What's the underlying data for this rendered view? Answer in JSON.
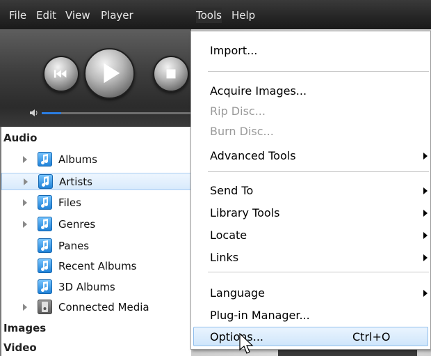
{
  "menubar": {
    "items": [
      "File",
      "Edit",
      "View",
      "Player",
      "Tools",
      "Help"
    ]
  },
  "library": {
    "audio_header": "Audio",
    "audio_items": [
      {
        "label": "Albums",
        "expandable": true
      },
      {
        "label": "Artists",
        "expandable": true,
        "selected": true
      },
      {
        "label": "Files",
        "expandable": true
      },
      {
        "label": "Genres",
        "expandable": true
      },
      {
        "label": "Panes",
        "expandable": false
      },
      {
        "label": "Recent Albums",
        "expandable": false
      },
      {
        "label": "3D Albums",
        "expandable": false
      },
      {
        "label": "Connected Media",
        "expandable": true
      }
    ],
    "images_header": "Images",
    "video_header": "Video"
  },
  "tools_menu": {
    "items": [
      {
        "label": "Import...",
        "disabled": false
      },
      {
        "label": "Acquire Images...",
        "disabled": false
      },
      {
        "label": "Rip Disc...",
        "disabled": true
      },
      {
        "label": "Burn Disc...",
        "disabled": true
      },
      {
        "label": "Advanced Tools",
        "submenu": true
      },
      {
        "label": "Send To",
        "submenu": true
      },
      {
        "label": "Library Tools",
        "submenu": true
      },
      {
        "label": "Locate",
        "submenu": true
      },
      {
        "label": "Links",
        "submenu": true
      },
      {
        "label": "Language",
        "submenu": true
      },
      {
        "label": "Plug-in Manager...",
        "disabled": false
      },
      {
        "label": "Options...",
        "shortcut": "Ctrl+O",
        "highlighted": true
      }
    ]
  },
  "colors": {
    "accent": "#2b7de1",
    "selection": "#d8eafc"
  }
}
